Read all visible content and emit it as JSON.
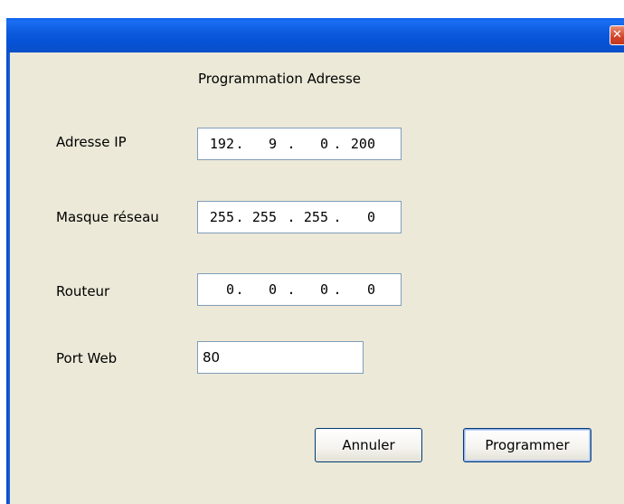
{
  "window": {
    "close_glyph": "✕"
  },
  "dialog": {
    "heading": "Programmation Adresse"
  },
  "fields": {
    "ip": {
      "label": "Adresse IP",
      "octets": [
        "192",
        "9",
        "0",
        "200"
      ]
    },
    "mask": {
      "label": "Masque réseau",
      "octets": [
        "255",
        "255",
        "255",
        "0"
      ]
    },
    "router": {
      "label": "Routeur",
      "octets": [
        "0",
        "0",
        "0",
        "0"
      ]
    },
    "port": {
      "label": "Port Web",
      "value": "80"
    }
  },
  "buttons": {
    "cancel_label": "Annuler",
    "program_label": "Programmer"
  },
  "colors": {
    "titlebar": "#0652d6",
    "dialog_bg": "#ece9d8",
    "field_border": "#7f9db9",
    "button_border": "#003c74",
    "close_button": "#d1432a"
  }
}
